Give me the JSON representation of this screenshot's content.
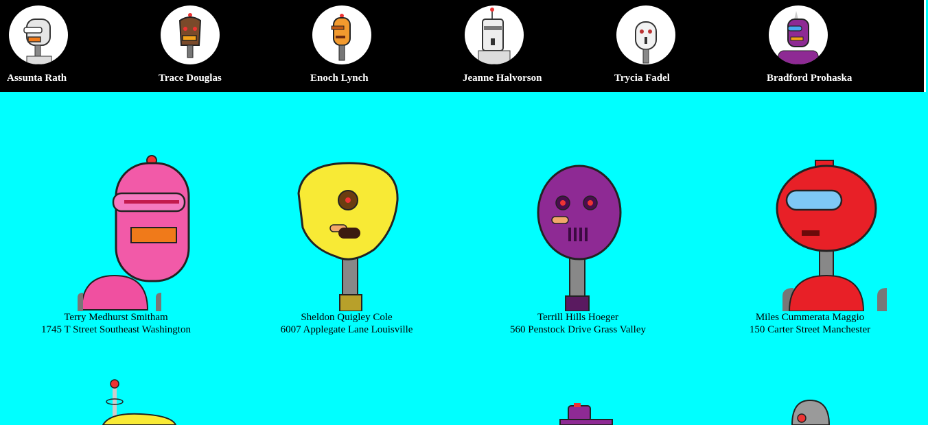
{
  "top_robots": [
    {
      "name": "Assunta Rath",
      "icon": "white-robot-avatar-icon"
    },
    {
      "name": "Trace Douglas",
      "icon": "brown-robot-avatar-icon"
    },
    {
      "name": "Enoch Lynch",
      "icon": "orange-robot-avatar-icon"
    },
    {
      "name": "Jeanne Halvorson",
      "icon": "white-antenna-robot-avatar-icon"
    },
    {
      "name": "Trycia Fadel",
      "icon": "white-round-robot-avatar-icon"
    },
    {
      "name": "Bradford Prohaska",
      "icon": "purple-robot-avatar-icon"
    }
  ],
  "grid_robots": [
    {
      "name": "Terry Medhurst Smitham",
      "address": "1745 T Street Southeast Washington",
      "icon": "pink-robot-icon",
      "color": "#f0509a"
    },
    {
      "name": "Sheldon Quigley Cole",
      "address": "6007 Applegate Lane Louisville",
      "icon": "yellow-robot-icon",
      "color": "#f8ea35"
    },
    {
      "name": "Terrill Hills Hoeger",
      "address": "560 Penstock Drive Grass Valley",
      "icon": "purple-robot-icon",
      "color": "#8e2a94"
    },
    {
      "name": "Miles Cummerata Maggio",
      "address": "150 Carter Street Manchester",
      "icon": "red-robot-icon",
      "color": "#e82027"
    }
  ],
  "colors": {
    "topbar": "#000000",
    "background": "#00ffff"
  }
}
